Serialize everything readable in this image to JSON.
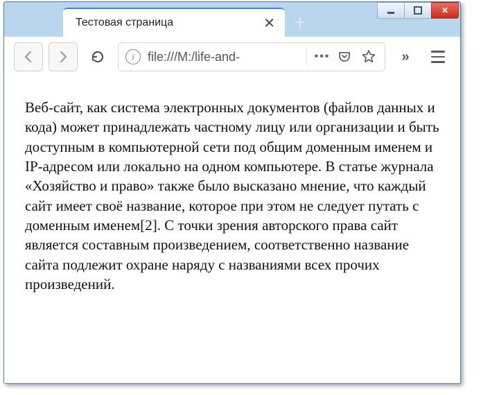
{
  "window": {
    "min_glyph": "▁",
    "max_glyph": "☐",
    "close_glyph": "✕"
  },
  "tab": {
    "title": "Тестовая страница",
    "close_glyph": "✕",
    "newtab_glyph": "+"
  },
  "toolbar": {
    "url_text": "file:///M:/life-and-",
    "info_glyph": "i",
    "more_glyph": "•••",
    "overflow_glyph": "»"
  },
  "page": {
    "body_text": "Веб-сайт, как система электронных документов (файлов данных и кода) может принадлежать частному лицу или организации и быть доступным в компьютерной сети под общим доменным именем и IP-адресом или локально на одном компьютере. В статье журнала «Хозяйство и право» также было высказано мнение, что каждый сайт имеет своё название, которое при этом не следует путать с доменным именем[2]. С точки зрения авторского права сайт является составным произведением, соответственно название сайта подлежит охране наряду с названиями всех прочих произведений."
  }
}
